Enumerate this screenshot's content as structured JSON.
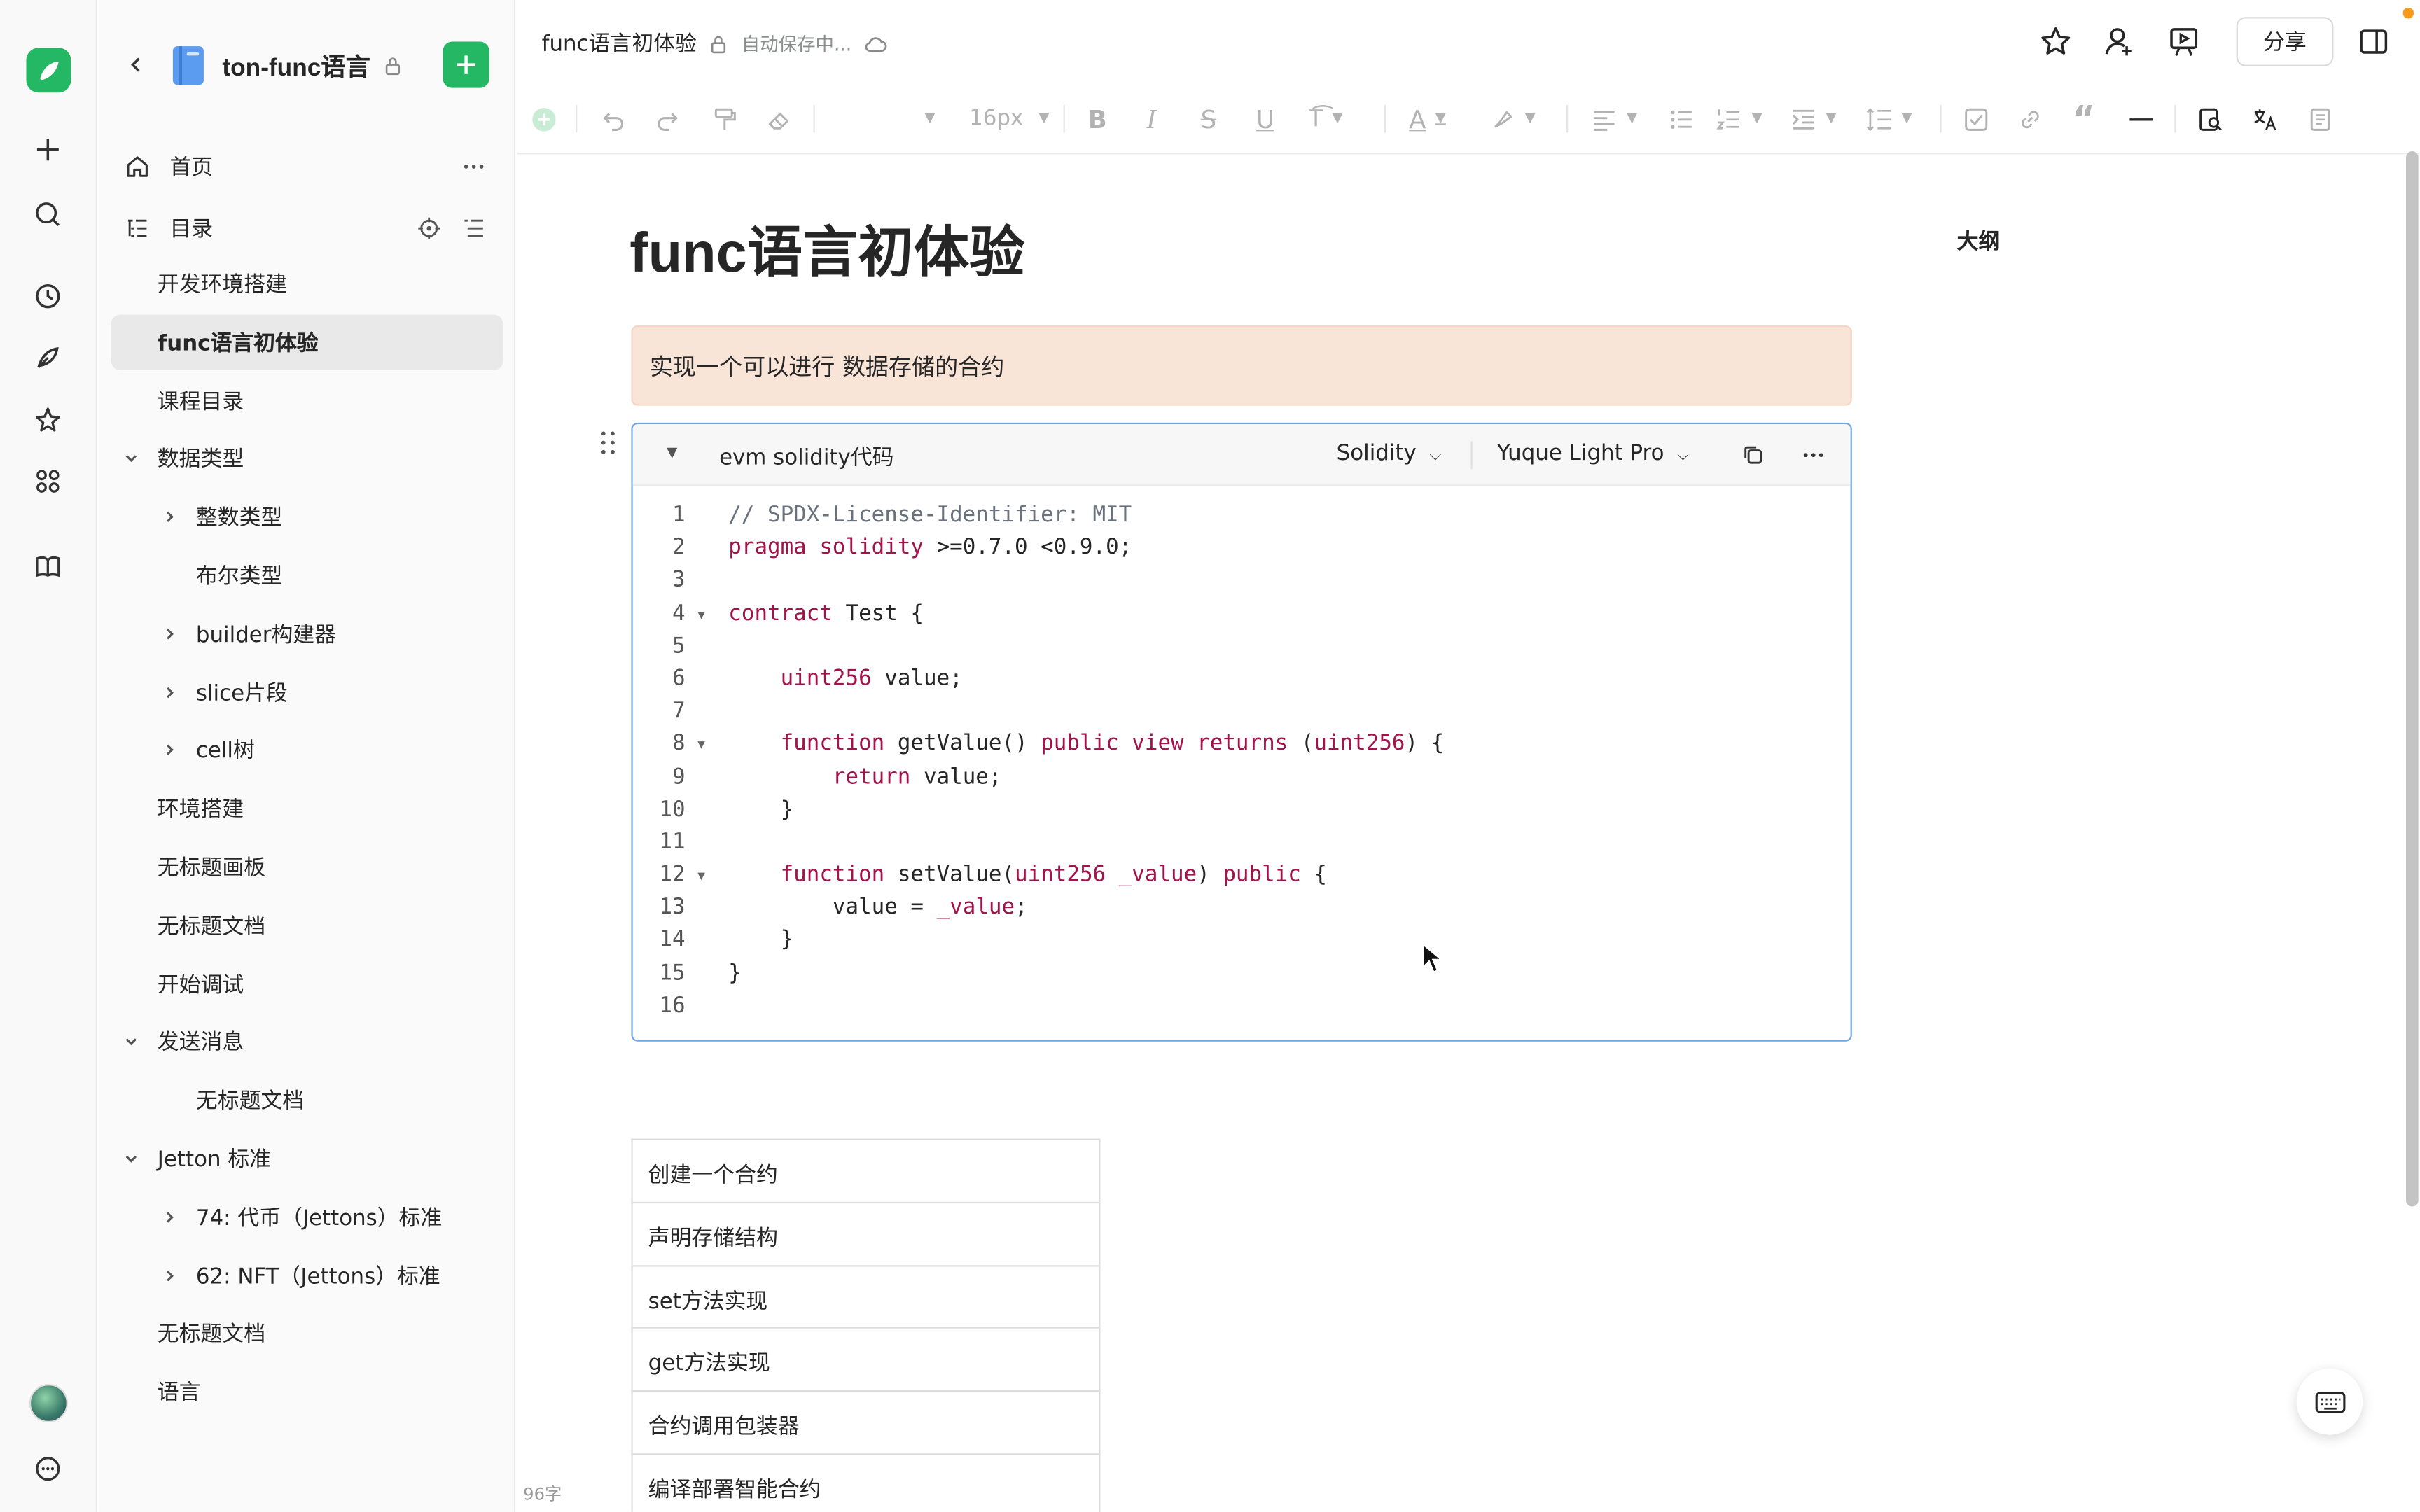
{
  "header": {
    "doc_crumb": "func语言初体验",
    "save_status": "自动保存中...",
    "share_label": "分享"
  },
  "sidebar": {
    "book_title": "ton-func语言",
    "home": "首页",
    "toc": "目录",
    "items": [
      {
        "label": "开发环境搭建",
        "level": 0
      },
      {
        "label": "func语言初体验",
        "level": 0,
        "active": true
      },
      {
        "label": "课程目录",
        "level": 0
      },
      {
        "label": "数据类型",
        "level": 0,
        "expanded": true
      },
      {
        "label": "整数类型",
        "level": 1,
        "collapsed": true
      },
      {
        "label": "布尔类型",
        "level": 1
      },
      {
        "label": "builder构建器",
        "level": 1,
        "collapsed": true
      },
      {
        "label": "slice片段",
        "level": 1,
        "collapsed": true
      },
      {
        "label": "cell树",
        "level": 1,
        "collapsed": true
      },
      {
        "label": "环境搭建",
        "level": 0
      },
      {
        "label": "无标题画板",
        "level": 0
      },
      {
        "label": "无标题文档",
        "level": 0
      },
      {
        "label": "开始调试",
        "level": 0
      },
      {
        "label": "发送消息",
        "level": 0,
        "expanded": true
      },
      {
        "label": "无标题文档",
        "level": 1
      },
      {
        "label": "Jetton 标准",
        "level": 0,
        "expanded": true
      },
      {
        "label": "74: 代币（Jettons）标准",
        "level": 1,
        "collapsed": true
      },
      {
        "label": "62: NFT（Jettons）标准",
        "level": 1,
        "collapsed": true
      },
      {
        "label": "无标题文档",
        "level": 0
      },
      {
        "label": "语言",
        "level": 0
      }
    ]
  },
  "toolbar": {
    "font_size": "16px"
  },
  "document": {
    "title": "func语言初体验",
    "outline_label": "大纲",
    "callout": "实现一个可以进行 数据存储的合约",
    "code_block": {
      "title": "evm solidity代码",
      "language": "Solidity",
      "theme": "Yuque Light Pro",
      "lines": [
        {
          "n": "1",
          "text": "// SPDX-License-Identifier: MIT"
        },
        {
          "n": "2",
          "text": "pragma solidity >=0.7.0 <0.9.0;"
        },
        {
          "n": "3",
          "text": ""
        },
        {
          "n": "4",
          "text": "contract Test {",
          "fold": true
        },
        {
          "n": "5",
          "text": ""
        },
        {
          "n": "6",
          "text": "    uint256 value;"
        },
        {
          "n": "7",
          "text": ""
        },
        {
          "n": "8",
          "text": "    function getValue() public view returns (uint256) {",
          "fold": true
        },
        {
          "n": "9",
          "text": "        return value;"
        },
        {
          "n": "10",
          "text": "    }"
        },
        {
          "n": "11",
          "text": ""
        },
        {
          "n": "12",
          "text": "    function setValue(uint256 _value) public {",
          "fold": true
        },
        {
          "n": "13",
          "text": "        value = _value;"
        },
        {
          "n": "14",
          "text": "    }"
        },
        {
          "n": "15",
          "text": "}"
        },
        {
          "n": "16",
          "text": ""
        }
      ]
    },
    "table_rows": [
      "创建一个合约",
      "声明存储结构",
      "set方法实现",
      "get方法实现",
      "合约调用包装器",
      "编译部署智能合约"
    ],
    "word_count": "96字"
  },
  "colors": {
    "brand": "#25b864",
    "callout_bg": "#f9e4d8",
    "code_border": "#6fa5e0",
    "keyword": "#a1134a"
  }
}
